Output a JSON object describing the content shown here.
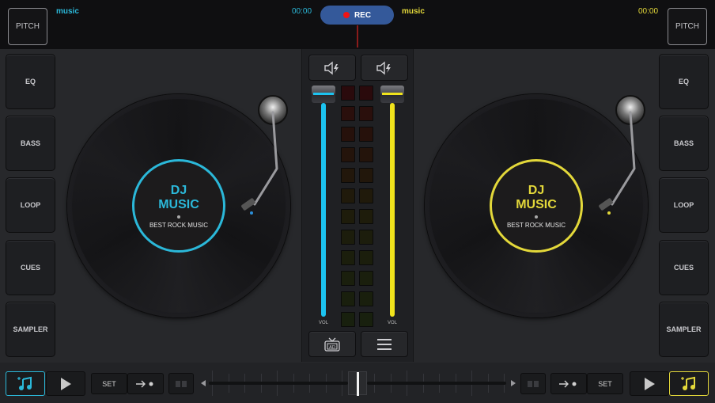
{
  "topbar": {
    "left_pitch_label": "PITCH",
    "right_pitch_label": "PITCH",
    "left_track": "music",
    "left_time": "00:00",
    "rec_label": "REC",
    "right_track": "music",
    "right_time": "00:00"
  },
  "left_pads": [
    "EQ",
    "BASS",
    "LOOP",
    "CUES",
    "SAMPLER"
  ],
  "right_pads": [
    "EQ",
    "BASS",
    "LOOP",
    "CUES",
    "SAMPLER"
  ],
  "decks": {
    "left": {
      "title_line1": "DJ",
      "title_line2": "MUSIC",
      "subtitle": "BEST ROCK MUSIC",
      "accent": "#2bb8d9"
    },
    "right": {
      "title_line1": "DJ",
      "title_line2": "MUSIC",
      "subtitle": "BEST ROCK MUSIC",
      "accent": "#e3d83a"
    }
  },
  "mixer": {
    "left_volume_label": "VOL",
    "right_volume_label": "VOL",
    "left_volume": 1.0,
    "right_volume": 1.0,
    "left_fader_color": "#1cc3f0",
    "right_fader_color": "#f0e31c",
    "vu_rows": 12,
    "vu_level": 0,
    "icons": [
      "speaker-effect-icon-left",
      "speaker-effect-icon-right",
      "ad-tv-icon",
      "menu-icon"
    ],
    "ad_label": "AD"
  },
  "bottombar": {
    "left_set_label": "SET",
    "right_set_label": "SET",
    "crossfader_position": 0.5
  },
  "colors": {
    "accent_left": "#2bb8d9",
    "accent_right": "#e3d83a",
    "rec_button": "#34599a",
    "rec_dot": "#f01414"
  }
}
